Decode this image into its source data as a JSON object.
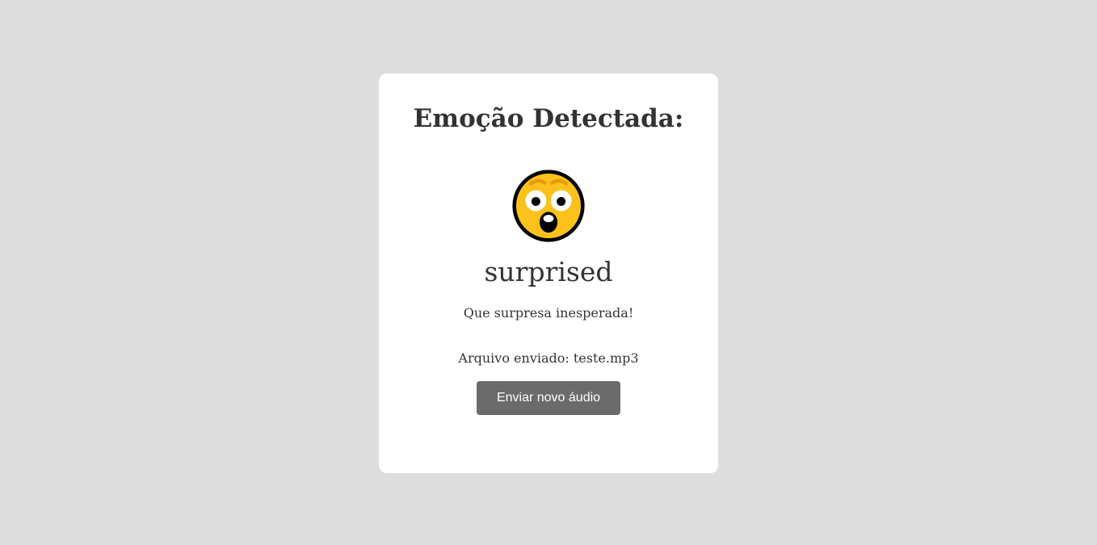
{
  "card": {
    "title": "Emoção Detectada:",
    "emoji_icon": "astonished-face-icon",
    "emotion_label": "surprised",
    "message": "Que surpresa inesperada!",
    "file_prefix": "Arquivo enviado:",
    "file_name": "teste.mp3",
    "button_label": "Enviar novo áudio"
  },
  "colors": {
    "background": "#dddddd",
    "card": "#ffffff",
    "text": "#333333",
    "button": "#6b6b6b",
    "button_text": "#ffffff",
    "emoji_face": "#fcc21b",
    "emoji_outline": "#000000"
  }
}
